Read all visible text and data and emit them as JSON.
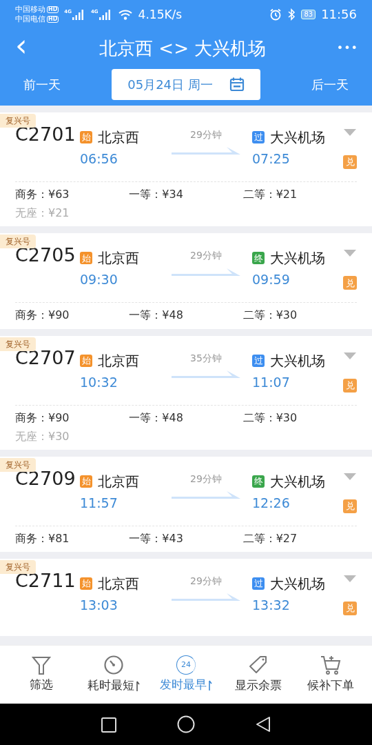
{
  "status_bar": {
    "carriers": [
      "中国移动",
      "中国电信"
    ],
    "hd_badges": [
      "HD",
      "HD"
    ],
    "network_labels": [
      "4G",
      "4G"
    ],
    "speed": "4.15K/s",
    "battery": "83",
    "time": "11:56"
  },
  "header": {
    "back": "‹",
    "title": "北京西 <> 大兴机场",
    "more": "•••"
  },
  "date_bar": {
    "prev": "前一天",
    "date": "05月24日 周一",
    "next": "后一天"
  },
  "trains": [
    {
      "tag": "复兴号",
      "number": "C2701",
      "from": {
        "kind": "start",
        "badge": "始",
        "station": "北京西",
        "time": "06:56"
      },
      "duration": "29分钟",
      "to": {
        "kind": "pass",
        "badge": "过",
        "station": "大兴机场",
        "time": "07:25"
      },
      "redeem": "兑",
      "seats": [
        {
          "text": "商务：¥63",
          "dimmed": false
        },
        {
          "text": "一等：¥34",
          "dimmed": false
        },
        {
          "text": "二等：¥21",
          "dimmed": false
        },
        {
          "text": "无座：¥21",
          "dimmed": true
        }
      ]
    },
    {
      "tag": "复兴号",
      "number": "C2705",
      "from": {
        "kind": "start",
        "badge": "始",
        "station": "北京西",
        "time": "09:30"
      },
      "duration": "29分钟",
      "to": {
        "kind": "end",
        "badge": "终",
        "station": "大兴机场",
        "time": "09:59"
      },
      "redeem": "兑",
      "seats": [
        {
          "text": "商务：¥90",
          "dimmed": false
        },
        {
          "text": "一等：¥48",
          "dimmed": false
        },
        {
          "text": "二等：¥30",
          "dimmed": false
        }
      ]
    },
    {
      "tag": "复兴号",
      "number": "C2707",
      "from": {
        "kind": "start",
        "badge": "始",
        "station": "北京西",
        "time": "10:32"
      },
      "duration": "35分钟",
      "to": {
        "kind": "pass",
        "badge": "过",
        "station": "大兴机场",
        "time": "11:07"
      },
      "redeem": "兑",
      "seats": [
        {
          "text": "商务：¥90",
          "dimmed": false
        },
        {
          "text": "一等：¥48",
          "dimmed": false
        },
        {
          "text": "二等：¥30",
          "dimmed": false
        },
        {
          "text": "无座：¥30",
          "dimmed": true
        }
      ]
    },
    {
      "tag": "复兴号",
      "number": "C2709",
      "from": {
        "kind": "start",
        "badge": "始",
        "station": "北京西",
        "time": "11:57"
      },
      "duration": "29分钟",
      "to": {
        "kind": "end",
        "badge": "终",
        "station": "大兴机场",
        "time": "12:26"
      },
      "redeem": "兑",
      "seats": [
        {
          "text": "商务：¥81",
          "dimmed": false
        },
        {
          "text": "一等：¥43",
          "dimmed": false
        },
        {
          "text": "二等：¥27",
          "dimmed": false
        }
      ]
    },
    {
      "tag": "复兴号",
      "number": "C2711",
      "from": {
        "kind": "start",
        "badge": "始",
        "station": "北京西",
        "time": "13:03"
      },
      "duration": "29分钟",
      "to": {
        "kind": "pass",
        "badge": "过",
        "station": "大兴机场",
        "time": "13:32"
      },
      "redeem": "兑"
    }
  ],
  "bottom_tabs": [
    {
      "kind": "filter",
      "label": "筛选",
      "sort": false,
      "selected": false
    },
    {
      "kind": "timer",
      "label": "耗时最短",
      "sort": true,
      "selected": false
    },
    {
      "kind": "clock24",
      "icon_text": "24",
      "label": "发时最早",
      "sort": true,
      "selected": true
    },
    {
      "kind": "tag",
      "label": "显示余票",
      "sort": false,
      "selected": false
    },
    {
      "kind": "cart",
      "label": "候补下单",
      "sort": false,
      "selected": false
    }
  ]
}
